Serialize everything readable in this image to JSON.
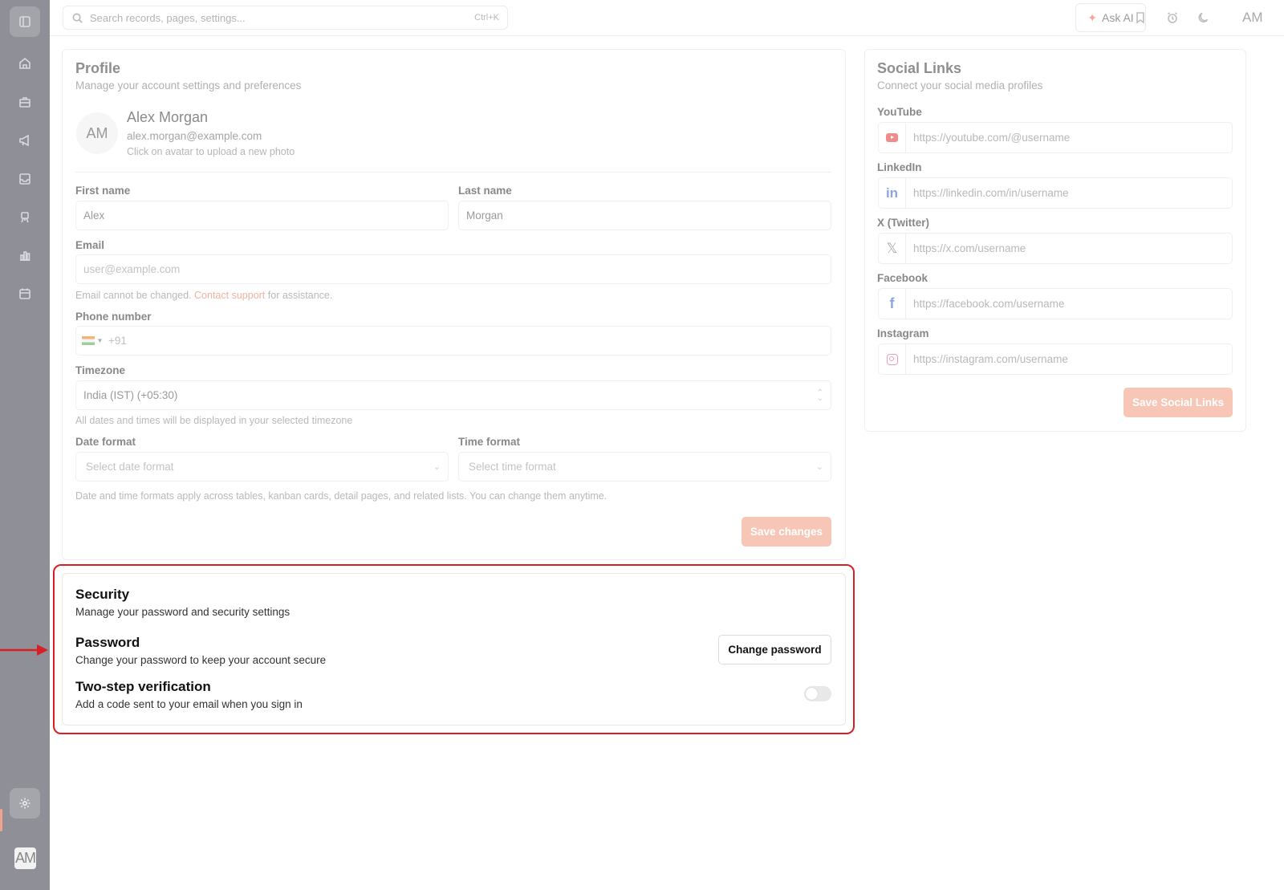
{
  "sidebar": {
    "avatar_initials": "AM",
    "items": [
      {
        "icon": "panel-toggle-icon"
      },
      {
        "icon": "home-icon"
      },
      {
        "icon": "briefcase-icon"
      },
      {
        "icon": "megaphone-icon"
      },
      {
        "icon": "inbox-icon"
      },
      {
        "icon": "easel-icon"
      },
      {
        "icon": "bar-chart-icon"
      },
      {
        "icon": "calendar-icon"
      },
      {
        "icon": "gear-icon",
        "active": true
      }
    ]
  },
  "topbar": {
    "search_placeholder": "Search records, pages, settings...",
    "search_shortcut": "Ctrl+K",
    "ask_ai_label": "Ask AI",
    "user_initials": "AM"
  },
  "profile": {
    "title": "Profile",
    "subtitle": "Manage your account settings and preferences",
    "avatar_initials": "AM",
    "name": "Alex Morgan",
    "email": "alex.morgan@example.com",
    "avatar_hint": "Click on avatar to upload a new photo",
    "first_name_label": "First name",
    "first_name_value": "Alex",
    "last_name_label": "Last name",
    "last_name_value": "Morgan",
    "email_label": "Email",
    "email_placeholder": "user@example.com",
    "email_hint_prefix": "Email cannot be changed.",
    "email_hint_link": "Contact support",
    "email_hint_suffix": "for assistance.",
    "phone_label": "Phone number",
    "phone_code": "+91",
    "timezone_label": "Timezone",
    "timezone_value": "India (IST) (+05:30)",
    "timezone_hint": "All dates and times will be displayed in your selected timezone",
    "date_format_label": "Date format",
    "date_format_placeholder": "Select date format",
    "time_format_label": "Time format",
    "time_format_placeholder": "Select time format",
    "format_hint": "Date and time formats apply across tables, kanban cards, detail pages, and related lists. You can change them anytime.",
    "save_label": "Save changes"
  },
  "social": {
    "title": "Social Links",
    "subtitle": "Connect your social media profiles",
    "links": [
      {
        "label": "YouTube",
        "placeholder": "https://youtube.com/@username",
        "icon": "youtube-icon"
      },
      {
        "label": "LinkedIn",
        "placeholder": "https://linkedin.com/in/username",
        "icon": "linkedin-icon"
      },
      {
        "label": "X (Twitter)",
        "placeholder": "https://x.com/username",
        "icon": "x-icon"
      },
      {
        "label": "Facebook",
        "placeholder": "https://facebook.com/username",
        "icon": "facebook-icon"
      },
      {
        "label": "Instagram",
        "placeholder": "https://instagram.com/username",
        "icon": "instagram-icon"
      }
    ],
    "save_label": "Save Social Links"
  },
  "security": {
    "title": "Security",
    "subtitle": "Manage your password and security settings",
    "password_title": "Password",
    "password_sub": "Change your password to keep your account secure",
    "change_password_label": "Change password",
    "twostep_title": "Two-step verification",
    "twostep_sub": "Add a code sent to your email when you sign in",
    "twostep_enabled": false
  },
  "colors": {
    "accent": "#f8c6b6",
    "highlight": "#d81f26",
    "sidebar": "#8f9097"
  }
}
